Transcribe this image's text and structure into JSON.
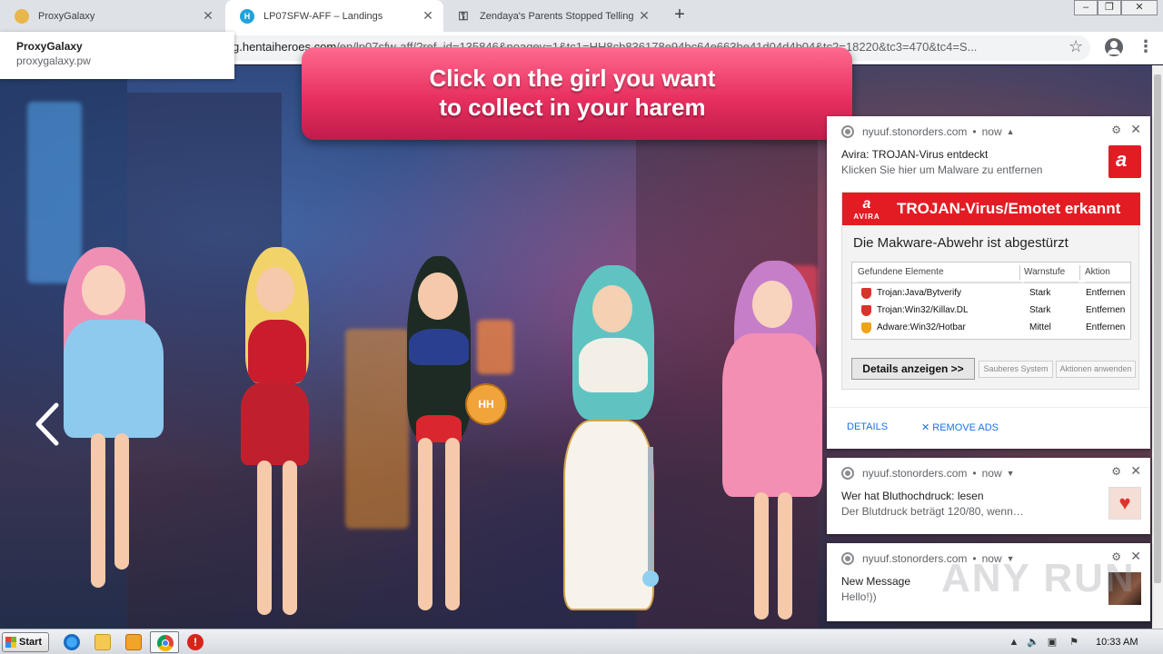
{
  "browser": {
    "tabs": [
      {
        "title": "ProxyGalaxy",
        "active": false
      },
      {
        "title": "LP07SFW-AFF – Landings",
        "active": true
      },
      {
        "title": "Zendaya's Parents Stopped Telling H",
        "active": false
      }
    ],
    "new_tab_symbol": "+",
    "url_prefix": "g.hentaiheroes.com",
    "url_rest": "/en/lp07sfw-aff/?ref_id=135846&noagev=1&tc1=HH8cb836178e94bc64e663be41d04d4b04&tc2=18220&tc3=470&tc4=S...",
    "tooltip": {
      "title": "ProxyGalaxy",
      "domain": "proxygalaxy.pw"
    }
  },
  "page": {
    "banner_text": "Click on the girl you want\nto collect in your harem",
    "ball_label": "HH"
  },
  "notifications": [
    {
      "source": "nyuuf.stonorders.com",
      "time": "now",
      "title": "Avira: TROJAN-Virus entdeckt",
      "message": "Klicken Sie hier um Malware zu entfernen",
      "panel": {
        "brand": "AVIRA",
        "heading": "TROJAN-Virus/Emotet erkannt",
        "subheading": "Die Makware-Abwehr ist abgestürzt",
        "columns": [
          "Gefundene Elemente",
          "Warnstufe",
          "Aktion"
        ],
        "rows": [
          {
            "name": "Trojan:Java/Bytverify",
            "level": "Stark",
            "action": "Entfernen",
            "color": "#d9342b"
          },
          {
            "name": "Trojan:Win32/Killav.DL",
            "level": "Stark",
            "action": "Entfernen",
            "color": "#d9342b"
          },
          {
            "name": "Adware:Win32/Hotbar",
            "level": "Mittel",
            "action": "Entfernen",
            "color": "#f0a21a"
          }
        ],
        "details_button": "Details anzeigen >>",
        "clean_button": "Sauberes System",
        "apply_button": "Aktionen anwenden"
      },
      "actions": {
        "details": "DETAILS",
        "remove_ads": "REMOVE ADS"
      }
    },
    {
      "source": "nyuuf.stonorders.com",
      "time": "now",
      "title": "Wer hat Bluthochdruck: lesen",
      "message": "Der Blutdruck beträgt 120/80, wenn…"
    },
    {
      "source": "nyuuf.stonorders.com",
      "time": "now",
      "title": "New Message",
      "message": "Hello!))"
    }
  ],
  "watermark": "ANY RUN",
  "taskbar": {
    "start_label": "Start",
    "clock": "10:33 AM"
  },
  "colors": {
    "banner": "#e7305f",
    "avira_red": "#e31c24",
    "link_blue": "#1a73e8"
  }
}
